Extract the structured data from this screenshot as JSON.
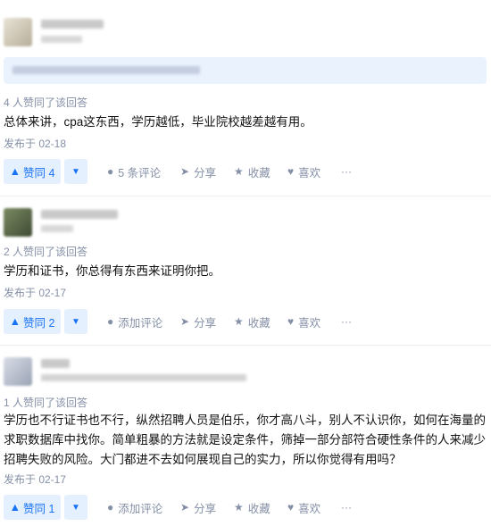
{
  "answers": [
    {
      "vote_line": "4 人赞同了该回答",
      "content": "总体来讲，cpa这东西，学历越低，毕业院校越差越有用。",
      "date": "发布于 02-18",
      "upvote": "赞同 4",
      "comment": "5 条评论",
      "share": "分享",
      "collect": "收藏",
      "like": "喜欢"
    },
    {
      "vote_line": "2 人赞同了该回答",
      "content": "学历和证书，你总得有东西来证明你把。",
      "date": "发布于 02-17",
      "upvote": "赞同 2",
      "comment": "添加评论",
      "share": "分享",
      "collect": "收藏",
      "like": "喜欢"
    },
    {
      "vote_line": "1 人赞同了该回答",
      "content": "学历也不行证书也不行，纵然招聘人员是伯乐，你才高八斗，别人不认识你，如何在海量的求职数据库中找你。简单粗暴的方法就是设定条件，筛掉一部分部符合硬性条件的人来减少招聘失败的风险。大门都进不去如何展现自己的实力，所以你觉得有用吗？",
      "date": "发布于 02-17",
      "upvote": "赞同 1",
      "comment": "添加评论",
      "share": "分享",
      "collect": "收藏",
      "like": "喜欢"
    }
  ],
  "icons": {
    "upvote": "triangle-up-icon",
    "downvote": "triangle-down-icon",
    "comment": "comment-bubble-icon",
    "share": "share-arrow-icon",
    "collect": "star-icon",
    "like": "heart-icon",
    "more": "more-dots-icon"
  },
  "colors": {
    "accent": "#1772f6",
    "vote_bg": "#e5f0ff",
    "meta": "#8590a6"
  }
}
